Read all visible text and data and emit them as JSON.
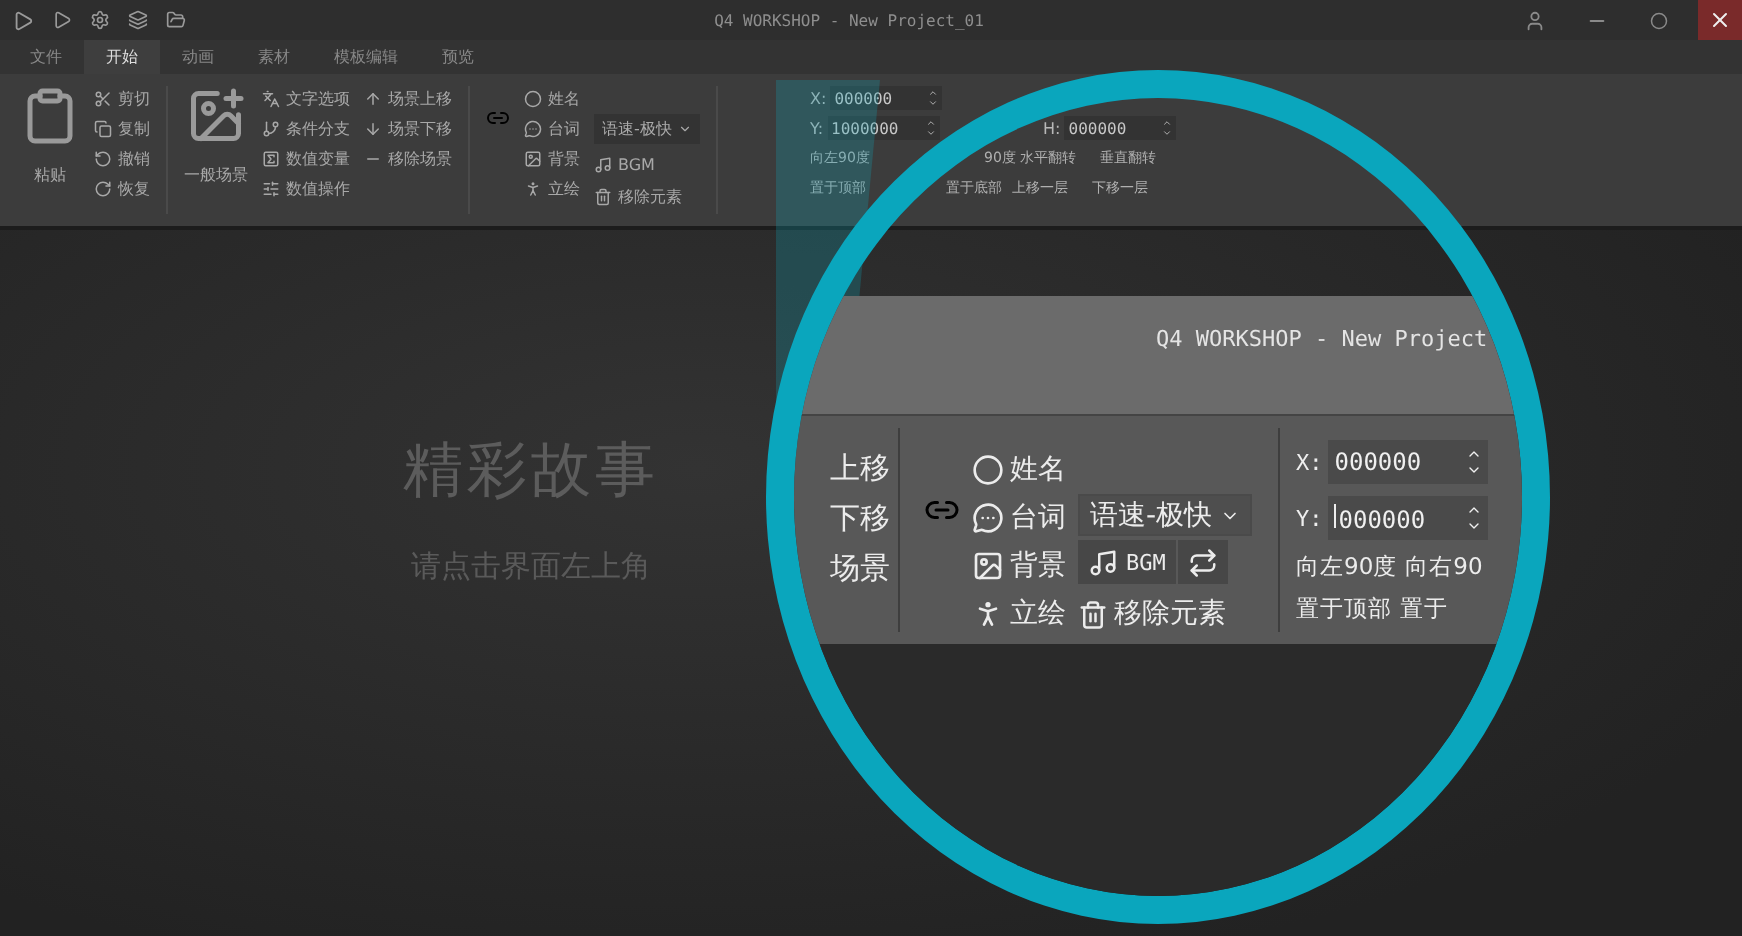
{
  "window": {
    "title": "Q4 WORKSHOP - New Project_01"
  },
  "tabs": [
    {
      "label": "文件",
      "selected": false
    },
    {
      "label": "开始",
      "selected": true
    },
    {
      "label": "动画",
      "selected": false
    },
    {
      "label": "素材",
      "selected": false
    },
    {
      "label": "模板编辑",
      "selected": false
    },
    {
      "label": "预览",
      "selected": false
    }
  ],
  "ribbon": {
    "paste": "粘贴",
    "edit": [
      "剪切",
      "复制",
      "撤销",
      "恢复"
    ],
    "scene": "一般场景",
    "logic": [
      "文字选项",
      "条件分支",
      "数值变量",
      "数值操作"
    ],
    "scene_moves": [
      "场景上移",
      "场景下移",
      "移除场景"
    ],
    "elements": [
      "姓名",
      "台词",
      "背景",
      "立绘"
    ],
    "speed": "语速-极快",
    "bgm": "BGM",
    "remove": "移除元素",
    "fields": [
      {
        "label": "X:",
        "value": "000000"
      },
      {
        "label": "Y:",
        "value": "1000000"
      }
    ],
    "fields_2": [
      {
        "label": "H:",
        "value": "000000"
      }
    ],
    "rotate": [
      "向左90度",
      "90度",
      "水平翻转",
      "垂直翻转"
    ],
    "order": [
      "置于顶部",
      "置于底部",
      "上移一层",
      "下移一层"
    ]
  },
  "empty_state": {
    "title": "精彩故事",
    "hint": "请点击界面左上角"
  },
  "magnifier": {
    "title": "Q4 WORKSHOP - New Project",
    "cut_labels": [
      "上移",
      "下移",
      "场景"
    ],
    "elements": [
      "姓名",
      "台词",
      "背景",
      "立绘"
    ],
    "speed": "语速-极快",
    "bgm": "BGM",
    "remove": "移除元素",
    "fields": [
      {
        "label": "X:",
        "value": "000000"
      },
      {
        "label": "Y:",
        "value": "000000"
      }
    ],
    "rotate": [
      "向左90度",
      "向右90"
    ],
    "order": [
      "置于顶部",
      "置于"
    ]
  }
}
